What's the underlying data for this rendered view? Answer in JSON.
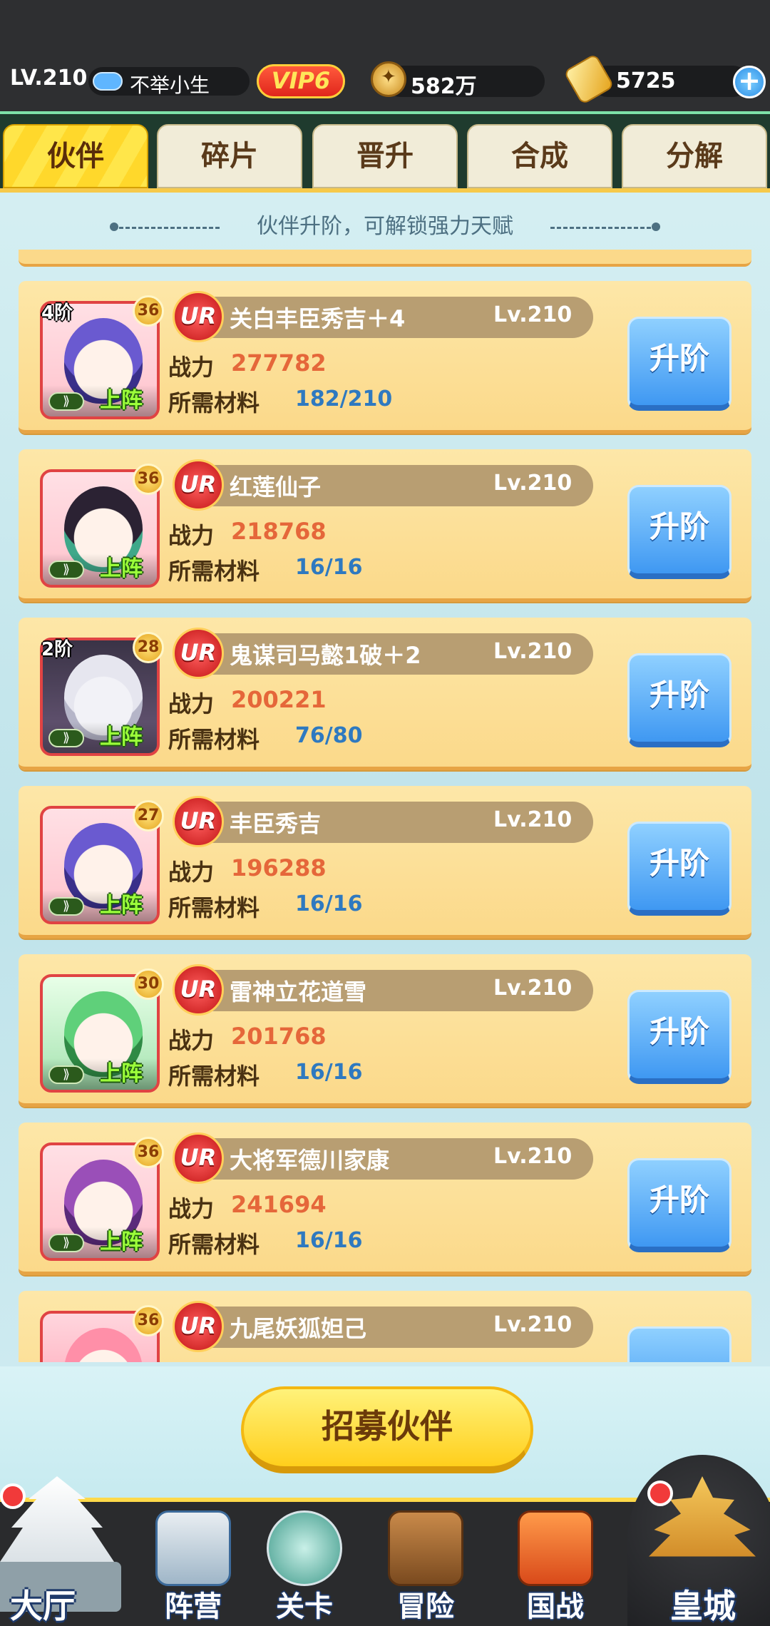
{
  "header": {
    "level": "LV.210",
    "player_name": "不举小生",
    "vip": "VIP6",
    "coins": "582万",
    "ingots": "5725",
    "plus_icon": "plus-icon"
  },
  "tabs": [
    "伙伴",
    "碎片",
    "晋升",
    "合成",
    "分解"
  ],
  "hint": "伙伴升阶，可解锁强力天赋",
  "labels": {
    "power": "战力",
    "materials": "所需材料",
    "upgrade": "升阶",
    "on_team": "上阵",
    "rarity": "UR"
  },
  "partners": [
    {
      "tier": "4阶",
      "stars": "36",
      "name": "关白丰臣秀吉＋4",
      "level": "Lv.210",
      "power": "277782",
      "materials": "182/210"
    },
    {
      "tier": "",
      "stars": "36",
      "name": "红莲仙子",
      "level": "Lv.210",
      "power": "218768",
      "materials": "16/16"
    },
    {
      "tier": "2阶",
      "stars": "28",
      "name": "鬼谋司马懿1破＋2",
      "level": "Lv.210",
      "power": "200221",
      "materials": "76/80"
    },
    {
      "tier": "",
      "stars": "27",
      "name": "丰臣秀吉",
      "level": "Lv.210",
      "power": "196288",
      "materials": "16/16"
    },
    {
      "tier": "",
      "stars": "30",
      "name": "雷神立花道雪",
      "level": "Lv.210",
      "power": "201768",
      "materials": "16/16"
    },
    {
      "tier": "",
      "stars": "36",
      "name": "大将军德川家康",
      "level": "Lv.210",
      "power": "241694",
      "materials": "16/16"
    },
    {
      "tier": "",
      "stars": "36",
      "name": "九尾妖狐妲己",
      "level": "Lv.210",
      "power": "",
      "materials": ""
    }
  ],
  "recruit_button": "招募伙伴",
  "nav": [
    "大厅",
    "阵营",
    "关卡",
    "冒险",
    "国战",
    "皇城"
  ],
  "colors": {
    "accent": "#ffd82b",
    "power": "#e5673a",
    "materials": "#2e79c0",
    "button_blue": "#3f98f2"
  }
}
